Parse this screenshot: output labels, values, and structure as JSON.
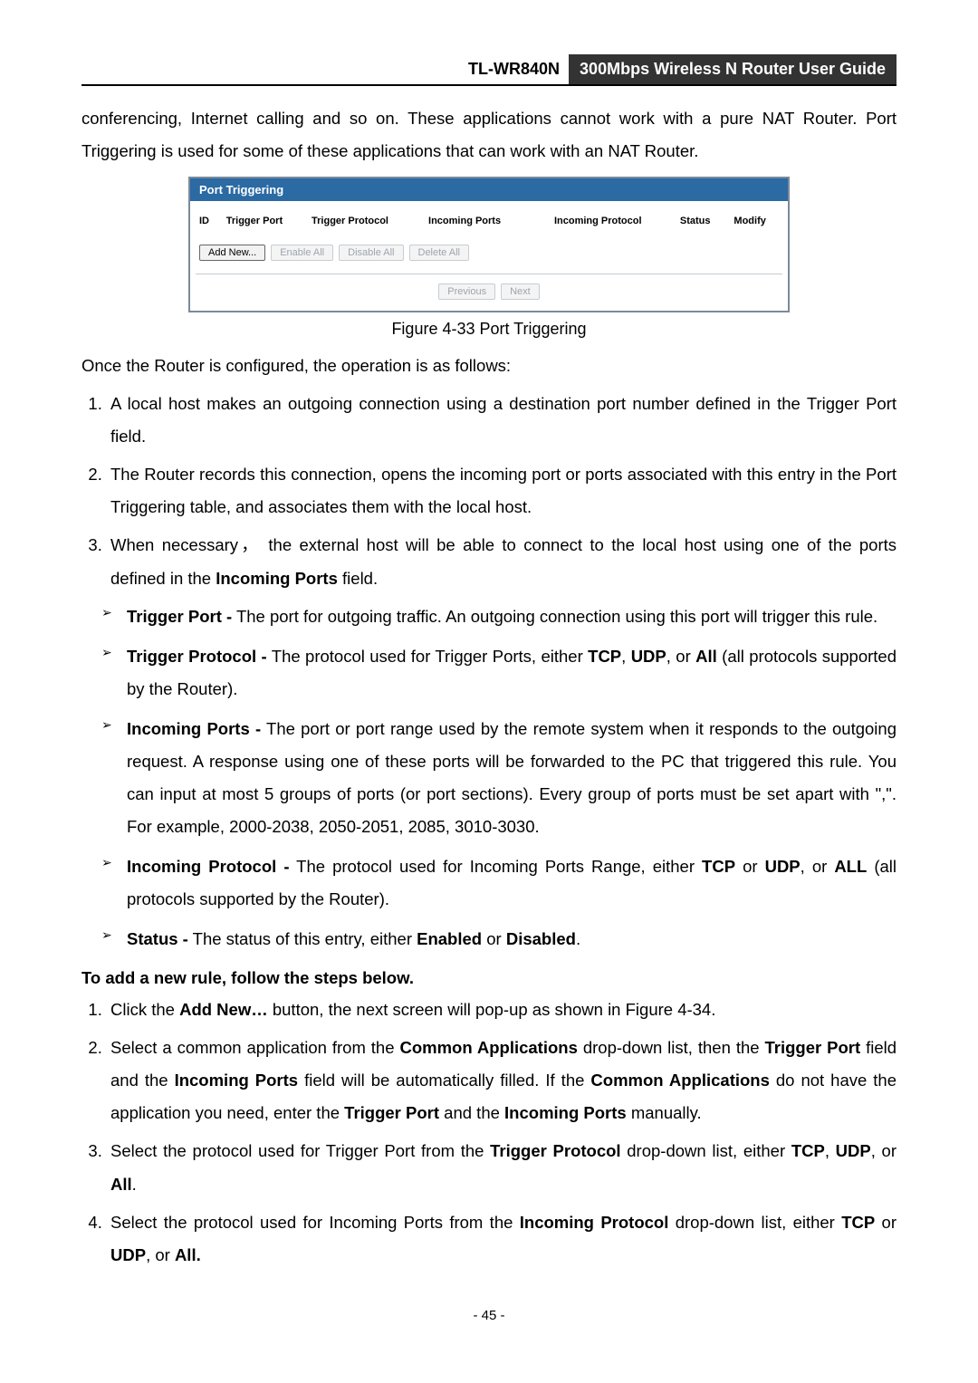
{
  "header": {
    "model": "TL-WR840N",
    "title": "300Mbps Wireless N Router User Guide"
  },
  "intro_para": "conferencing, Internet calling and so on. These applications cannot work with a pure NAT Router. Port Triggering is used for some of these applications that can work with an NAT Router.",
  "screenshot": {
    "title": "Port Triggering",
    "cols": {
      "id": "ID",
      "trigger_port": "Trigger Port",
      "trigger_protocol": "Trigger Protocol",
      "incoming_ports": "Incoming Ports",
      "incoming_protocol": "Incoming Protocol",
      "status": "Status",
      "modify": "Modify"
    },
    "buttons": {
      "add_new": "Add New...",
      "enable_all": "Enable All",
      "disable_all": "Disable All",
      "delete_all": "Delete All",
      "previous": "Previous",
      "next": "Next"
    }
  },
  "figure_caption": "Figure 4-33   Port Triggering",
  "once_intro": "Once the Router is configured, the operation is as follows:",
  "steps_primary": [
    "A local host makes an outgoing connection using a destination port number defined in the Trigger Port field.",
    "The Router records this connection, opens the incoming port or ports associated with this entry in the Port Triggering table, and associates them with the local host.",
    "When necessary，  the external host will be able to connect to the local host using one of the ports defined in the <b>Incoming Ports</b> field."
  ],
  "bullets": [
    "<b>Trigger Port -</b> The port for outgoing traffic. An outgoing connection using this port will trigger this rule.",
    "<b>Trigger Protocol -</b> The protocol used for Trigger Ports, either <b>TCP</b>, <b>UDP</b>, or <b>All</b> (all protocols supported by the Router).",
    "<b>Incoming Ports -</b> The port or port range used by the remote system when it responds to the outgoing request. A response using one of these ports will be forwarded to the PC that triggered this rule. You can input at most 5 groups of ports (or port sections). Every group of ports must be set apart with \",\". For example, 2000-2038, 2050-2051, 2085, 3010-3030.",
    "<b>Incoming Protocol -</b> The protocol used for Incoming Ports Range, either <b>TCP</b> or <b>UDP</b>, or <b>ALL</b> (all protocols supported by the Router).",
    "<b>Status -</b> The status of this entry, either <b>Enabled</b> or <b>Disabled</b>."
  ],
  "add_rule_heading": "To add a new rule, follow the steps below.",
  "steps_add": [
    "Click the <b>Add New…</b> button, the next screen will pop-up as shown in Figure 4-34.",
    "Select a common application from the <b>Common Applications</b> drop-down list, then the <b>Trigger Port</b> field and the <b>Incoming Ports</b> field will be automatically filled. If the <b>Common Applications</b> do not have the application you need, enter the <b>Trigger Port</b> and the <b>Incoming Ports</b> manually.",
    "Select the protocol used for Trigger Port from the <b>Trigger Protocol</b> drop-down list, either <b>TCP</b>, <b>UDP</b>, or <b>All</b>.",
    "Select the protocol used for Incoming Ports from the <b>Incoming Protocol</b> drop-down list, either <b>TCP</b> or <b>UDP</b>, or <b>All.</b>"
  ],
  "page_number": "- 45 -"
}
